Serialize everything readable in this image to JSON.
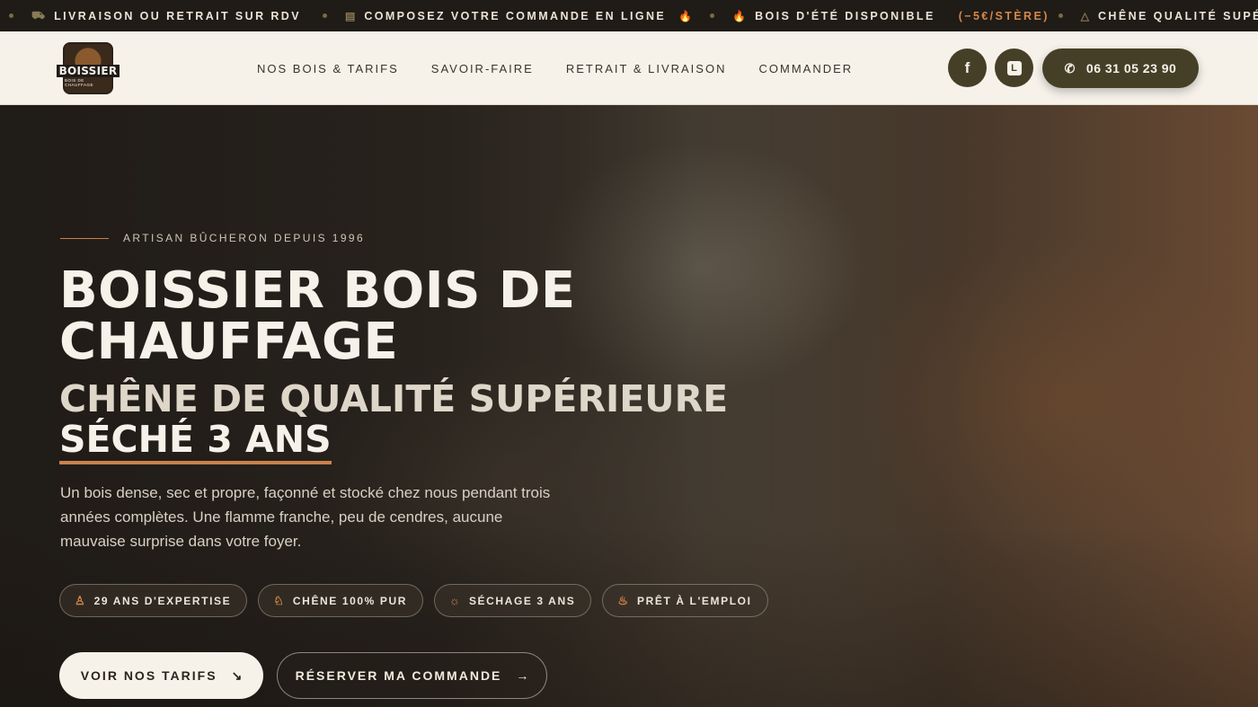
{
  "ticker": {
    "items": [
      {
        "icon": "truck-icon",
        "glyph": "⛟",
        "text": "LIVRAISON OU RETRAIT SUR RDV"
      },
      {
        "icon": "clipboard-icon",
        "glyph": "▤",
        "text": "COMPOSEZ VOTRE COMMANDE EN LIGNE",
        "trail_glyph": "🔥"
      },
      {
        "icon": "fire-icon",
        "glyph": "🔥",
        "text": "BOIS D'ÉTÉ DISPONIBLE",
        "accent": "(−5€/STÈRE)"
      },
      {
        "icon": "bell-icon",
        "glyph": "△",
        "text": "CHÊNE QUALITÉ SUPÉRIEURE SÉC"
      }
    ]
  },
  "header": {
    "logo": {
      "word": "BOISSIER",
      "sub": "BOIS DE CHAUFFAGE"
    },
    "nav": [
      "NOS BOIS & TARIFS",
      "SAVOIR-FAIRE",
      "RETRAIT & LIVRAISON",
      "COMMANDER"
    ],
    "social": {
      "facebook": "f",
      "other": "L"
    },
    "phone": "06 31 05 23 90"
  },
  "hero": {
    "eyebrow": "ARTISAN BÛCHERON DEPUIS 1996",
    "title": "BOISSIER BOIS DE CHAUFFAGE",
    "subtitle_line1": "CHÊNE DE QUALITÉ SUPÉRIEURE",
    "subtitle_line2": "SÉCHÉ 3 ANS",
    "description": "Un bois dense, sec et propre, façonné et stocké chez nous pendant trois années complètes. Une flamme franche, peu de cendres, aucune mauvaise surprise dans votre foyer.",
    "badges": [
      {
        "icon": "award-icon",
        "glyph": "♙",
        "label": "29 ANS D'EXPERTISE"
      },
      {
        "icon": "bell-icon",
        "glyph": "♘",
        "label": "CHÊNE 100% PUR"
      },
      {
        "icon": "sun-icon",
        "glyph": "☼",
        "label": "SÉCHAGE 3 ANS"
      },
      {
        "icon": "flame-icon",
        "glyph": "♨",
        "label": "PRÊT À L'EMPLOI"
      }
    ],
    "cta_primary": "VOIR NOS TARIFS",
    "cta_secondary": "RÉSERVER MA COMMANDE"
  },
  "colors": {
    "accent": "#c9814a",
    "olive": "#463f27",
    "cream": "#f6f2ea"
  }
}
